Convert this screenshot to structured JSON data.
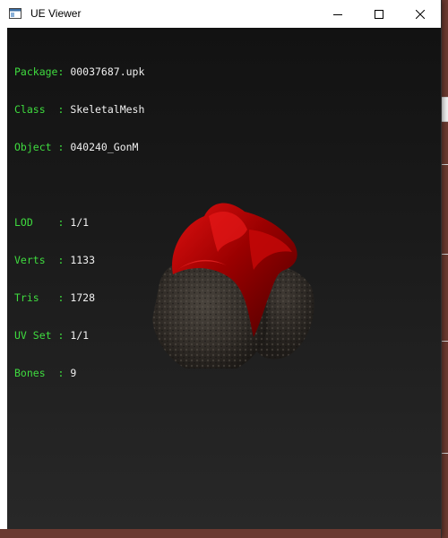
{
  "window": {
    "title": "UE Viewer",
    "controls": [
      "minimize-icon",
      "maximize-icon",
      "close-icon"
    ]
  },
  "info": {
    "package": {
      "label": "Package: ",
      "value": "00037687.upk"
    },
    "class": {
      "label": "Class  : ",
      "value": "SkeletalMesh"
    },
    "object": {
      "label": "Object : ",
      "value": "040240_GonM"
    },
    "lod": {
      "label": "LOD    : ",
      "value": "1/1"
    },
    "verts": {
      "label": "Verts  : ",
      "value": "1133"
    },
    "tris": {
      "label": "Tris   : ",
      "value": "1728"
    },
    "uvset": {
      "label": "UV Set : ",
      "value": "1/1"
    },
    "bones": {
      "label": "Bones  : ",
      "value": "9"
    }
  },
  "colors": {
    "label_green": "#3fdc3f",
    "value_white": "#f0f0f0",
    "viewport_bg": "#1a1a1a",
    "mesh_red": "#b00000",
    "mesh_fur": "#3a3530",
    "bone_purple": "#a020c8"
  }
}
